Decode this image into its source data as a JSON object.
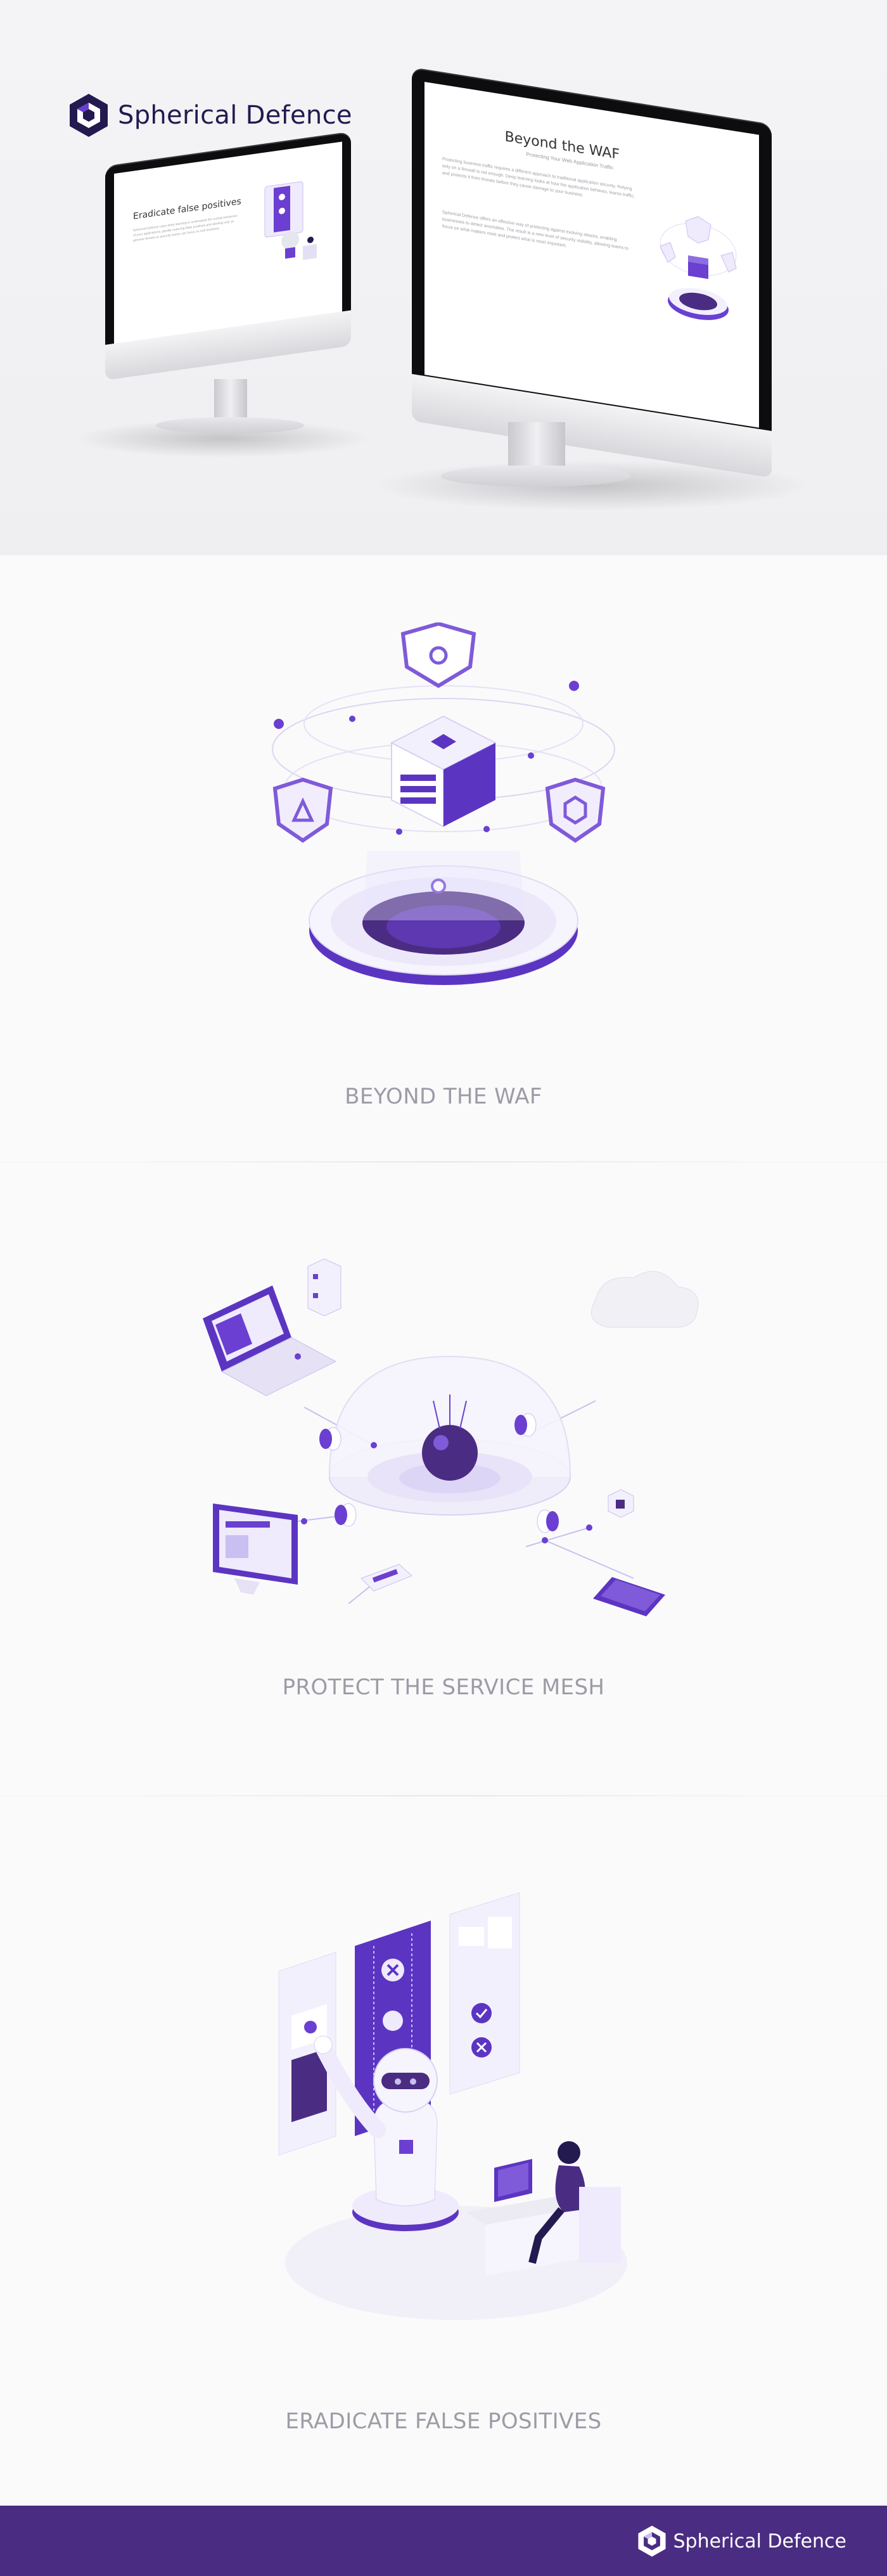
{
  "brand": {
    "name": "Spherical Defence",
    "logo_icon": "hexagon-logo-icon"
  },
  "hero": {
    "large_screen": {
      "title": "Beyond the WAF",
      "subtitle": "Protecting Your Web Application Traffic",
      "paragraph_1": "Protecting business traffic requires a different approach to traditional application security. Relying only on a firewall is not enough. Deep learning looks at how the application behaves, learns traffic, and protects it from threats before they cause damage to your business.",
      "paragraph_2": "Spherical Defence offers an effective way of protecting against evolving attacks, enabling businesses to detect anomalies. The result is a new level of security visibility, allowing teams to focus on what matters most and protect what is most important."
    },
    "small_screen": {
      "title": "Eradicate false positives",
      "paragraph": "Spherical Defence uses deep learning to understand the normal behaviour of your applications, greatly reducing false positives and alerting only on genuine threats so security teams can focus on real incidents."
    }
  },
  "sections": [
    {
      "caption": "BEYOND THE WAF",
      "illustration_icon": "shielded-server-portal-illustration"
    },
    {
      "caption": "PROTECT THE SERVICE MESH",
      "illustration_icon": "service-mesh-dome-illustration"
    },
    {
      "caption": "ERADICATE FALSE POSITIVES",
      "illustration_icon": "robot-analyst-illustration"
    }
  ],
  "footer": {
    "brand_name": "Spherical Defence"
  },
  "colors": {
    "primary_purple": "#4a2d82",
    "accent_purple": "#6a3fd1",
    "light_purple": "#c9bff0",
    "brand_navy": "#231a4f",
    "caption_gray": "#9c9ca6"
  }
}
